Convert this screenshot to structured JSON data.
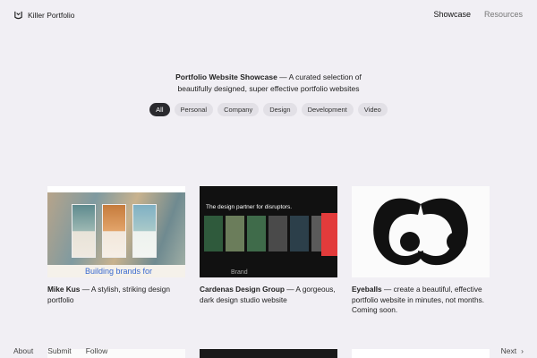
{
  "header": {
    "logo_text": "Killer Portfolio",
    "nav": {
      "showcase": "Showcase",
      "resources": "Resources"
    }
  },
  "hero": {
    "title": "Portfolio Website Showcase",
    "tagline": " — A curated selection of",
    "line2": "beautifully designed, super effective portfolio websites"
  },
  "filters": [
    "All",
    "Personal",
    "Company",
    "Design",
    "Development",
    "Video"
  ],
  "cards": [
    {
      "name": "Mike Kus",
      "desc": " — A stylish, striking design portfolio",
      "thumb_text": "Building brands for"
    },
    {
      "name": "Cardenas Design Group",
      "desc": " — A gorgeous, dark design studio website",
      "thumb_text": "The design partner for disruptors.",
      "thumb_footer": "Brand"
    },
    {
      "name": "Eyeballs",
      "desc": " — create a beautiful, effective portfolio website in minutes, not months. Coming soon."
    }
  ],
  "footer": {
    "about": "About",
    "submit": "Submit",
    "follow": "Follow",
    "next": "Next"
  },
  "colors": {
    "background": "#f1eff4",
    "chip_active": "#2a2a2e",
    "chip": "#e2e0e6"
  }
}
